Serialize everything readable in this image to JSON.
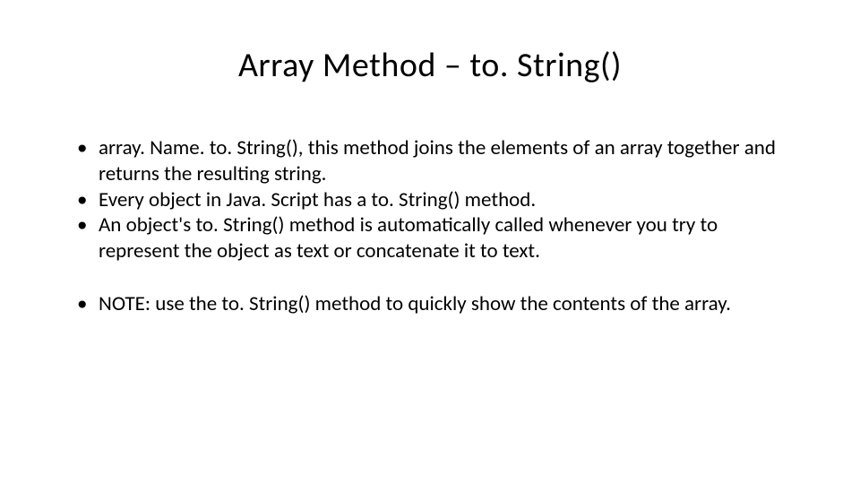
{
  "slide": {
    "title": "Array Method – to. String()",
    "bullets": [
      "array. Name. to. String(), this method joins the elements of an array together and returns the resulting string.",
      "Every object in Java. Script has a to. String() method.",
      "An object's to. String() method is automatically called whenever you try to represent the object as text or concatenate it to text."
    ],
    "note": "NOTE: use the to. String() method to quickly show the contents of the array."
  }
}
